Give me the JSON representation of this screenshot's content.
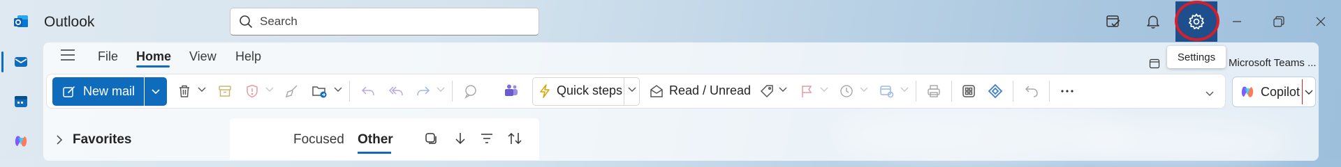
{
  "titlebar": {
    "app_name": "Outlook",
    "search_placeholder": "Search",
    "settings_tooltip": "Settings"
  },
  "menu": {
    "tabs": [
      "File",
      "Home",
      "View",
      "Help"
    ],
    "active_tab": "Home",
    "teams_chip": "Microsoft Teams ..."
  },
  "ribbon": {
    "new_mail_label": "New mail",
    "quick_steps_label": "Quick steps",
    "read_unread_label": "Read / Unread",
    "copilot_label": "Copilot",
    "more_label": "···"
  },
  "left_pane": {
    "favorites_label": "Favorites"
  },
  "message_list": {
    "tabs": [
      "Focused",
      "Other"
    ],
    "active_tab": "Other"
  },
  "colors": {
    "accent": "#0f6cbd",
    "settings_highlight": "#1f4e8c",
    "annotation_ring": "#d3202a"
  }
}
